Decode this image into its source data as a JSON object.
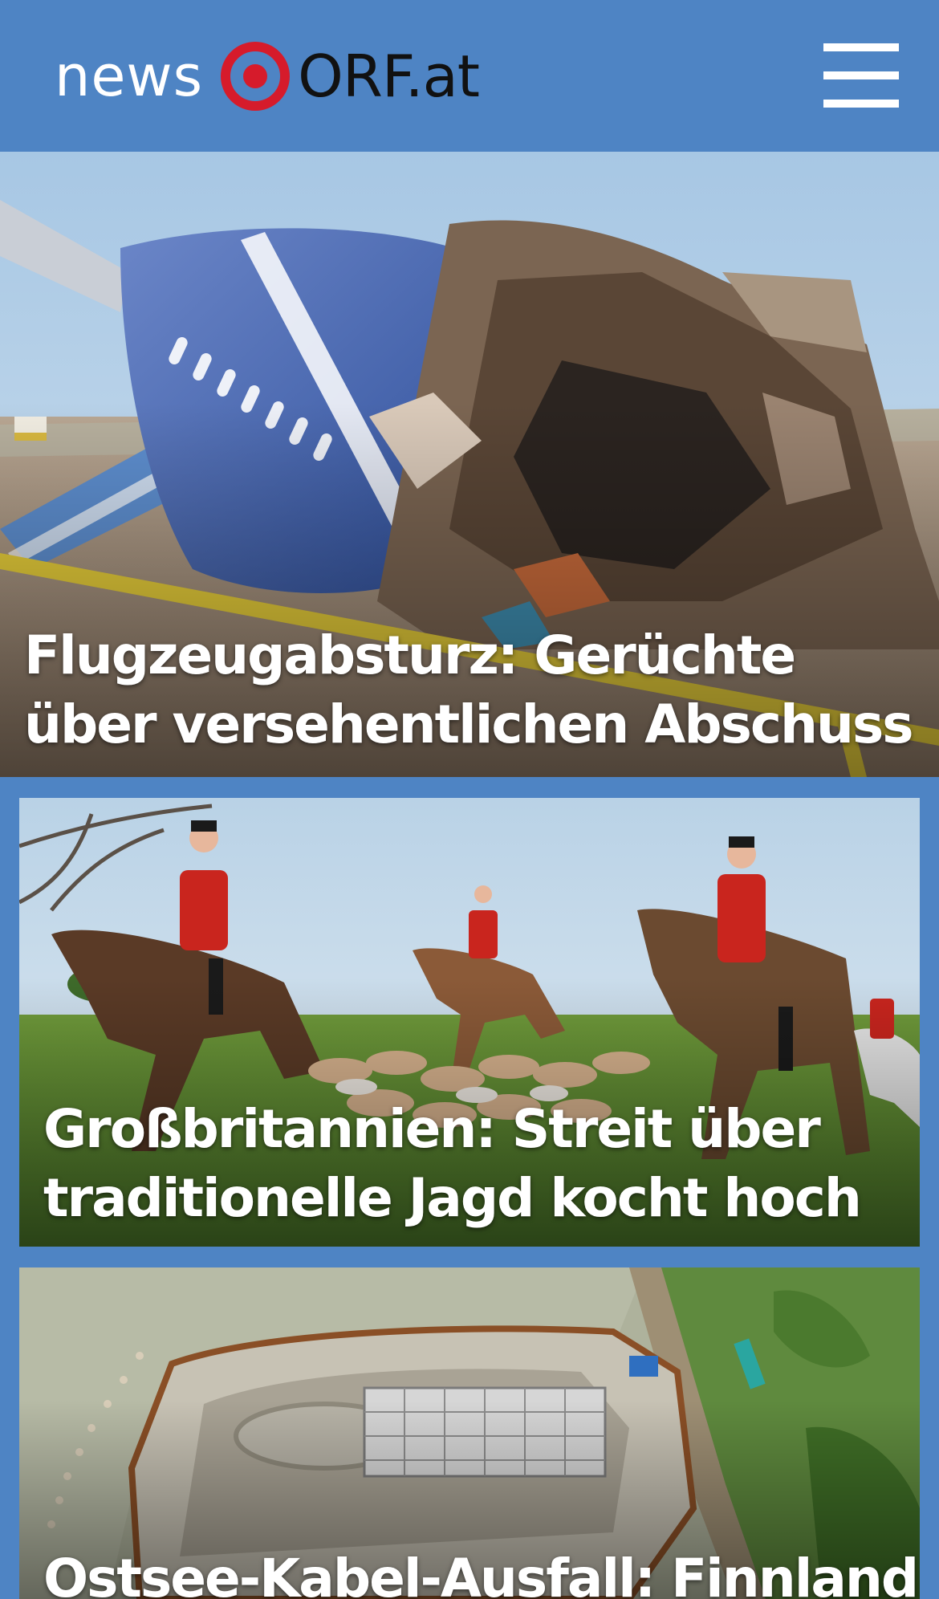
{
  "header": {
    "logo_news": "news",
    "logo_orf": "ORF.at",
    "brand_color": "#4e84c4",
    "logo_mark_color": "#d61b2b",
    "menu_icon": "hamburger-menu-icon"
  },
  "stories": [
    {
      "headline": "Flugzeugabsturz: Gerüchte über versehentlichen Abschuss",
      "image": "plane-wreck-photo"
    },
    {
      "headline": "Großbritannien: Streit über traditionelle Jagd kocht hoch",
      "image": "fox-hunt-riders-photo"
    },
    {
      "headline": "Ostsee-Kabel-Ausfall: Finnland",
      "image": "coastal-construction-site-photo"
    }
  ]
}
